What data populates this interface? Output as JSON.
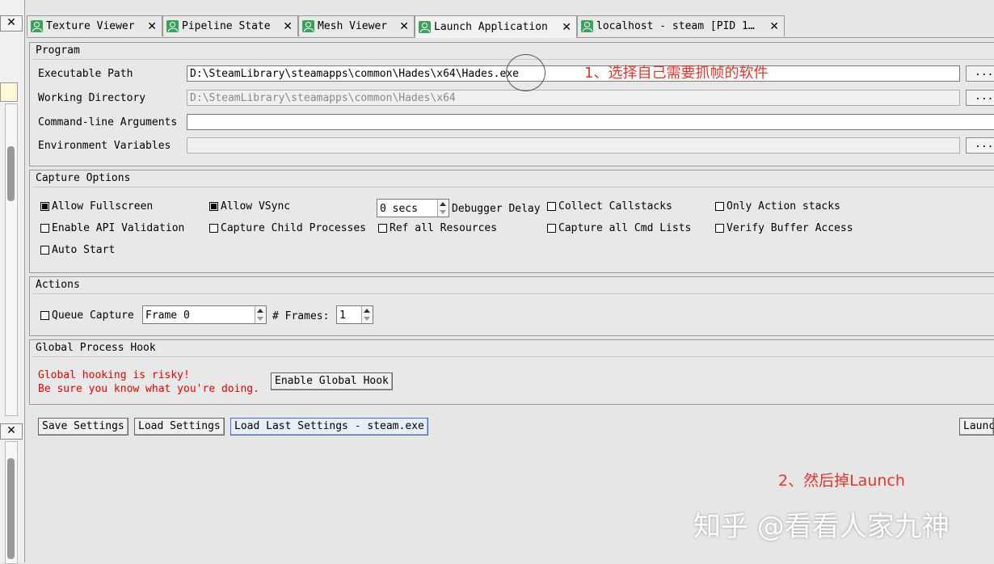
{
  "left_dock": {
    "close_glyph": "✕"
  },
  "tabs": [
    {
      "label": "Texture Viewer",
      "close": "✕"
    },
    {
      "label": "Pipeline State",
      "close": "✕"
    },
    {
      "label": "Mesh Viewer",
      "close": "✕"
    },
    {
      "label": "Launch Application",
      "close": "✕"
    },
    {
      "label": "localhost - steam [PID 1…",
      "close": "✕"
    }
  ],
  "program": {
    "title": "Program",
    "exe_label": "Executable Path",
    "exe_value": "D:\\SteamLibrary\\steamapps\\common\\Hades\\x64\\Hades.exe",
    "workdir_label": "Working Directory",
    "workdir_placeholder": "D:\\SteamLibrary\\steamapps\\common\\Hades\\x64",
    "args_label": "Command-line Arguments",
    "args_value": "",
    "env_label": "Environment Variables",
    "browse": "..."
  },
  "capture": {
    "title": "Capture Options",
    "allow_fullscreen": "Allow Fullscreen",
    "allow_vsync": "Allow VSync",
    "delay_value": "0 secs",
    "debugger_delay": "Debugger Delay",
    "collect_callstacks": "Collect Callstacks",
    "only_action_stacks": "Only Action stacks",
    "enable_api_validation": "Enable API Validation",
    "capture_child": "Capture Child Processes",
    "ref_all_resources": "Ref all Resources",
    "capture_all_cmd": "Capture all Cmd Lists",
    "verify_buffer": "Verify Buffer Access",
    "auto_start": "Auto Start"
  },
  "actions": {
    "title": "Actions",
    "queue_capture": "Queue Capture",
    "frame_value": "Frame 0",
    "frames_label": "# Frames:",
    "frames_value": "1"
  },
  "hook": {
    "title": "Global Process Hook",
    "warning_line1": "Global hooking is risky!",
    "warning_line2": "Be sure you know what you're doing.",
    "enable_button": "Enable Global Hook"
  },
  "bottom": {
    "save": "Save Settings",
    "load": "Load Settings",
    "load_last": "Load Last Settings - steam.exe",
    "launch": "Launch"
  },
  "annotations": {
    "step1": "1、选择自己需要抓帧的软件",
    "step2": "2、然后掉Launch",
    "watermark": "知乎 @看看人家九神"
  },
  "colors": {
    "annotation": "#e4352a",
    "warning": "#e00000",
    "tab_icon": "#3aa35a"
  }
}
